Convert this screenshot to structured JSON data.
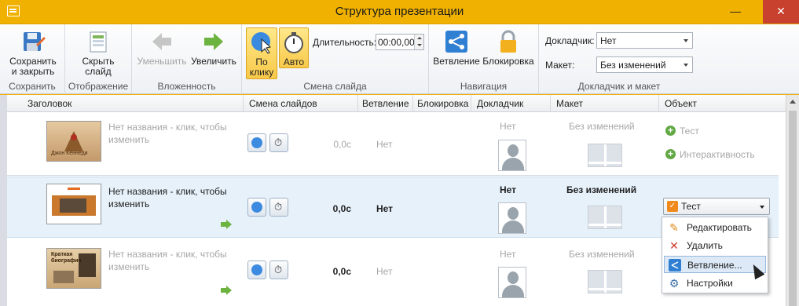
{
  "window": {
    "title": "Структура презентации"
  },
  "ribbon": {
    "save": {
      "label_line1": "Сохранить",
      "label_line2": "и закрыть",
      "group": "Сохранить"
    },
    "display": {
      "label_line1": "Скрыть",
      "label_line2": "слайд",
      "group": "Отображение"
    },
    "nesting": {
      "decrease": "Уменьшить",
      "increase": "Увеличить",
      "group": "Вложенность"
    },
    "slide_change": {
      "on_click_line1": "По",
      "on_click_line2": "клику",
      "auto": "Авто",
      "duration_label": "Длительность:",
      "duration_value": "00:00,00",
      "group": "Смена слайда"
    },
    "navigation": {
      "branching": "Ветвление",
      "lock": "Блокировка",
      "group": "Навигация"
    },
    "speaker_layout": {
      "speaker_label": "Докладчик:",
      "speaker_value": "Нет",
      "layout_label": "Макет:",
      "layout_value": "Без изменений",
      "group": "Докладчик и макет"
    }
  },
  "grid": {
    "headers": [
      "Заголовок",
      "Смена слайдов",
      "Ветвление",
      "Блокировка",
      "Докладчик",
      "Макет",
      "Объект"
    ],
    "rows": [
      {
        "title": "Нет названия - клик, чтобы изменить",
        "time": "0,0с",
        "branching": "Нет",
        "speaker": "Нет",
        "layout": "Без изменений",
        "obj1": "Тест",
        "obj2": "Интерактивность",
        "thumb_caption": "Джон Кеннеди"
      },
      {
        "title": "Нет названия - клик, чтобы изменить",
        "time": "0,0с",
        "branching": "Нет",
        "speaker": "Нет",
        "layout": "Без изменений",
        "object": "Тест"
      },
      {
        "title": "Нет названия - клик, чтобы изменить",
        "time": "0,0с",
        "branching": "Нет",
        "speaker": "Нет",
        "layout": "Без изменений",
        "thumb_caption": "Краткая биография"
      }
    ]
  },
  "menu": {
    "items": [
      "Редактировать",
      "Удалить",
      "Ветвление...",
      "Настройки"
    ]
  },
  "colors": {
    "titlebar": "#f0b100",
    "selection": "#e6f1fa",
    "accent_green": "#6cb33f",
    "close": "#c8402e"
  }
}
